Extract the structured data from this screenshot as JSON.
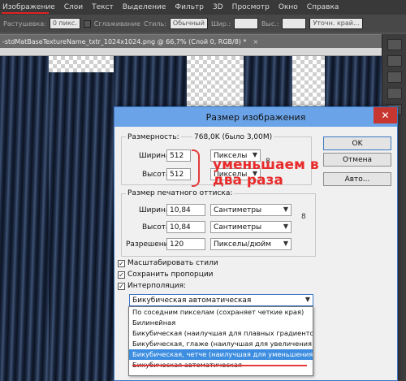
{
  "menu": {
    "items": [
      "Изображение",
      "Слои",
      "Текст",
      "Выделение",
      "Фильтр",
      "3D",
      "Просмотр",
      "Окно",
      "Справка"
    ]
  },
  "options_bar": {
    "feather_label": "Растушевка:",
    "feather_value": "0 пикс.",
    "antialias_label": "Сглаживание",
    "style_label": "Стиль:",
    "style_value": "Обычный",
    "width_label": "Шир.:",
    "height_label": "Выс.:",
    "refine_label": "Уточн. край..."
  },
  "document": {
    "tab_title": "-stdMatBaseTextureName_txtr_1024x1024.png @ 66,7% (Слой 0, RGB/8) *",
    "close": "×"
  },
  "dialog": {
    "title": "Размер изображения",
    "close": "✕",
    "pixel_dims": {
      "label": "Размерность:",
      "value": "768,0K (было 3,00M)",
      "width_label": "Ширина:",
      "width_value": "512",
      "width_unit": "Пикселы",
      "height_label": "Высота:",
      "height_value": "512",
      "height_unit": "Пикселы"
    },
    "annotation_line1": "уменьшаем в",
    "annotation_line2": "два раза",
    "print_size": {
      "title": "Размер печатного оттиска:",
      "width_label": "Ширина:",
      "width_value": "10,84",
      "width_unit": "Сантиметры",
      "height_label": "Высота:",
      "height_value": "10,84",
      "height_unit": "Сантиметры",
      "resolution_label": "Разрешение:",
      "resolution_value": "120",
      "resolution_unit": "Пикселы/дюйм"
    },
    "checkboxes": {
      "scale_styles": "Масштабировать стили",
      "constrain": "Сохранить пропорции",
      "resample": "Интерполяция:",
      "checked": true
    },
    "resample_value": "Бикубическая автоматическая",
    "buttons": {
      "ok": "OK",
      "cancel": "Отмена",
      "auto": "Авто..."
    },
    "resample_options": [
      "По соседним пикселам (сохраняет четкие края)",
      "Билинейная",
      "Бикубическая (наилучшая для плавных градиентов)",
      "Бикубическая, глаже (наилучшая для увеличения)",
      "Бикубическая, четче (наилучшая для уменьшения)",
      "Бикубическая автоматическая"
    ],
    "highlighted_option_index": 4
  },
  "colors": {
    "accent": "#3d8ee0",
    "annotation": "#e82b2b",
    "titlebar": "#6aa3e8"
  }
}
